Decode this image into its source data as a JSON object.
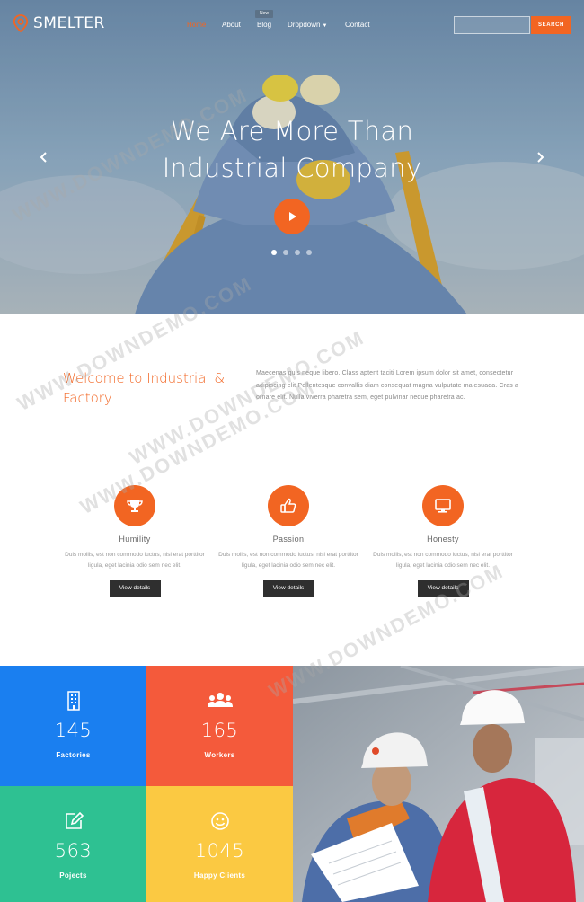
{
  "brand": {
    "name": "SMELTER"
  },
  "nav": {
    "items": [
      "Home",
      "About",
      "Blog",
      "Dropdown",
      "Contact"
    ],
    "active_index": 0,
    "blog_badge": "New"
  },
  "search": {
    "placeholder": "",
    "button_label": "SEARCH"
  },
  "hero": {
    "title_line1": "We Are More Than",
    "title_line2": "Industrial Company",
    "slide_count": 4,
    "active_slide": 0
  },
  "welcome": {
    "title": "Welcome to Industrial & Factory",
    "text": "Maecenas quis neque libero. Class aptent taciti Lorem ipsum dolor sit amet, consectetur adipiscing elit Pellentesque convallis diam consequat magna vulputate malesuada. Cras a ornare elit. Nulla viverra pharetra sem, eget pulvinar neque pharetra ac."
  },
  "features": [
    {
      "icon": "trophy-icon",
      "title": "Humility",
      "text": "Duis mollis, est non commodo luctus, nisi erat porttitor ligula, eget lacinia odio sem nec elit.",
      "button": "View details"
    },
    {
      "icon": "thumbs-up-icon",
      "title": "Passion",
      "text": "Duis mollis, est non commodo luctus, nisi erat porttitor ligula, eget lacinia odio sem nec elit.",
      "button": "View details"
    },
    {
      "icon": "monitor-icon",
      "title": "Honesty",
      "text": "Duis mollis, est non commodo luctus, nisi erat porttitor ligula, eget lacinia odio sem nec elit.",
      "button": "View details"
    }
  ],
  "stats": [
    {
      "icon": "building-icon",
      "value": "145",
      "label": "Factories",
      "color": "#1a7ff0"
    },
    {
      "icon": "users-icon",
      "value": "165",
      "label": "Workers",
      "color": "#f45a3b"
    },
    {
      "icon": "edit-icon",
      "value": "563",
      "label": "Pojects",
      "color": "#2ec192"
    },
    {
      "icon": "smile-icon",
      "value": "1045",
      "label": "Happy Clients",
      "color": "#fbc942"
    }
  ],
  "colors": {
    "accent": "#f26522",
    "dark_button": "#2f2f2f"
  }
}
